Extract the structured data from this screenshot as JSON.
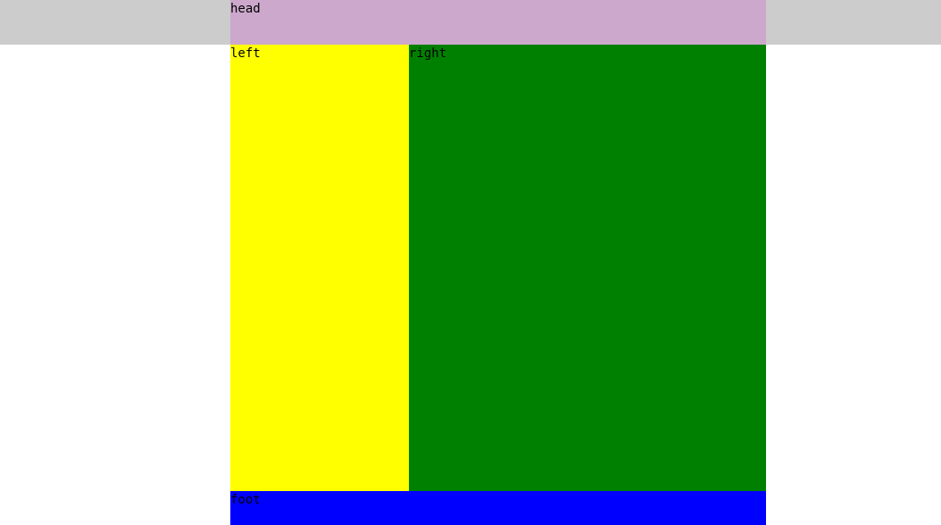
{
  "layout_regions": {
    "head": {
      "label": "head"
    },
    "left": {
      "label": "left"
    },
    "right": {
      "label": "right"
    },
    "foot": {
      "label": "foot"
    }
  },
  "colors": {
    "page_background": "#ffffff",
    "head_band": "#cccccc",
    "head": "#cca8cc",
    "left": "#ffff00",
    "right": "#008000",
    "foot": "#0000ff",
    "text": "#000000"
  }
}
